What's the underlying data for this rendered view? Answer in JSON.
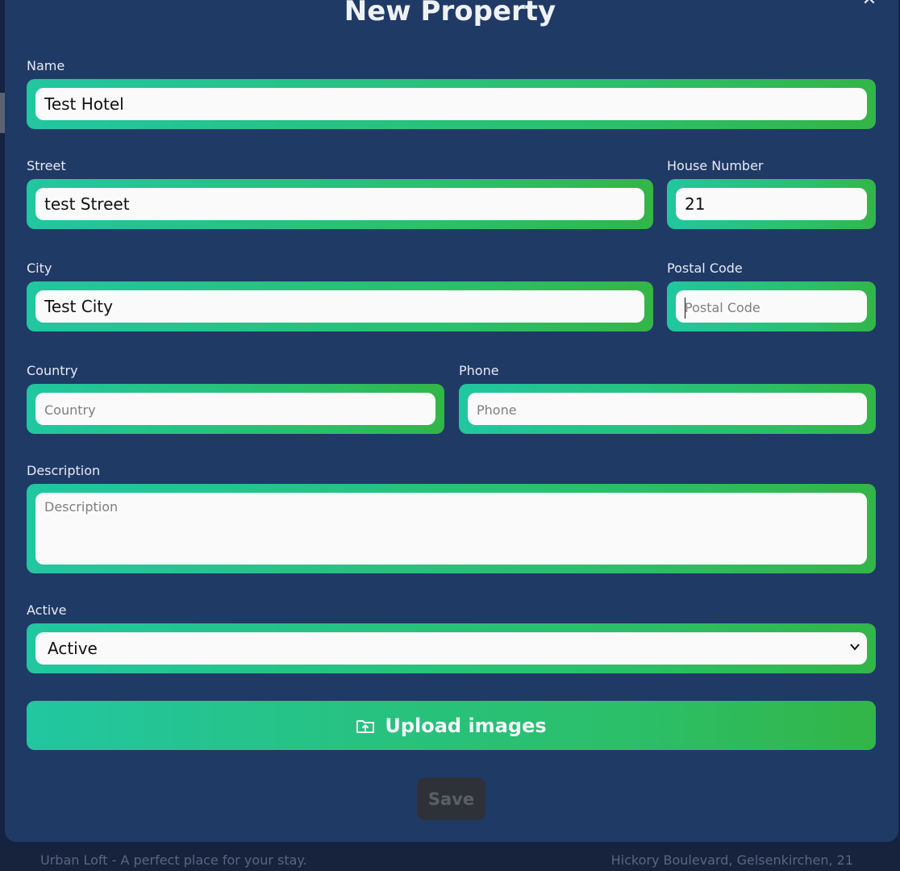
{
  "modal": {
    "title": "New Property",
    "close_icon": "close-icon"
  },
  "fields": {
    "name": {
      "label": "Name",
      "value": "Test Hotel"
    },
    "street": {
      "label": "Street",
      "value": "test Street"
    },
    "house_number": {
      "label": "House Number",
      "value": "21"
    },
    "city": {
      "label": "City",
      "value": "Test City"
    },
    "postal_code": {
      "label": "Postal Code",
      "value": "",
      "placeholder": "Postal Code"
    },
    "country": {
      "label": "Country",
      "value": "",
      "placeholder": "Country"
    },
    "phone": {
      "label": "Phone",
      "value": "",
      "placeholder": "Phone"
    },
    "description": {
      "label": "Description",
      "value": "",
      "placeholder": "Description"
    },
    "active": {
      "label": "Active",
      "selected": "Active"
    }
  },
  "actions": {
    "upload_label": "Upload images",
    "upload_icon": "upload-folder-icon",
    "save_label": "Save"
  },
  "background": {
    "footer_left": "Urban Loft - A perfect place for your stay.",
    "footer_right": "Hickory Boulevard, Gelsenkirchen, 21"
  },
  "colors": {
    "modal_bg": "#203a66",
    "gradient_start": "#22c6a0",
    "gradient_end": "#33b548",
    "save_disabled_bg": "#2e3238"
  }
}
